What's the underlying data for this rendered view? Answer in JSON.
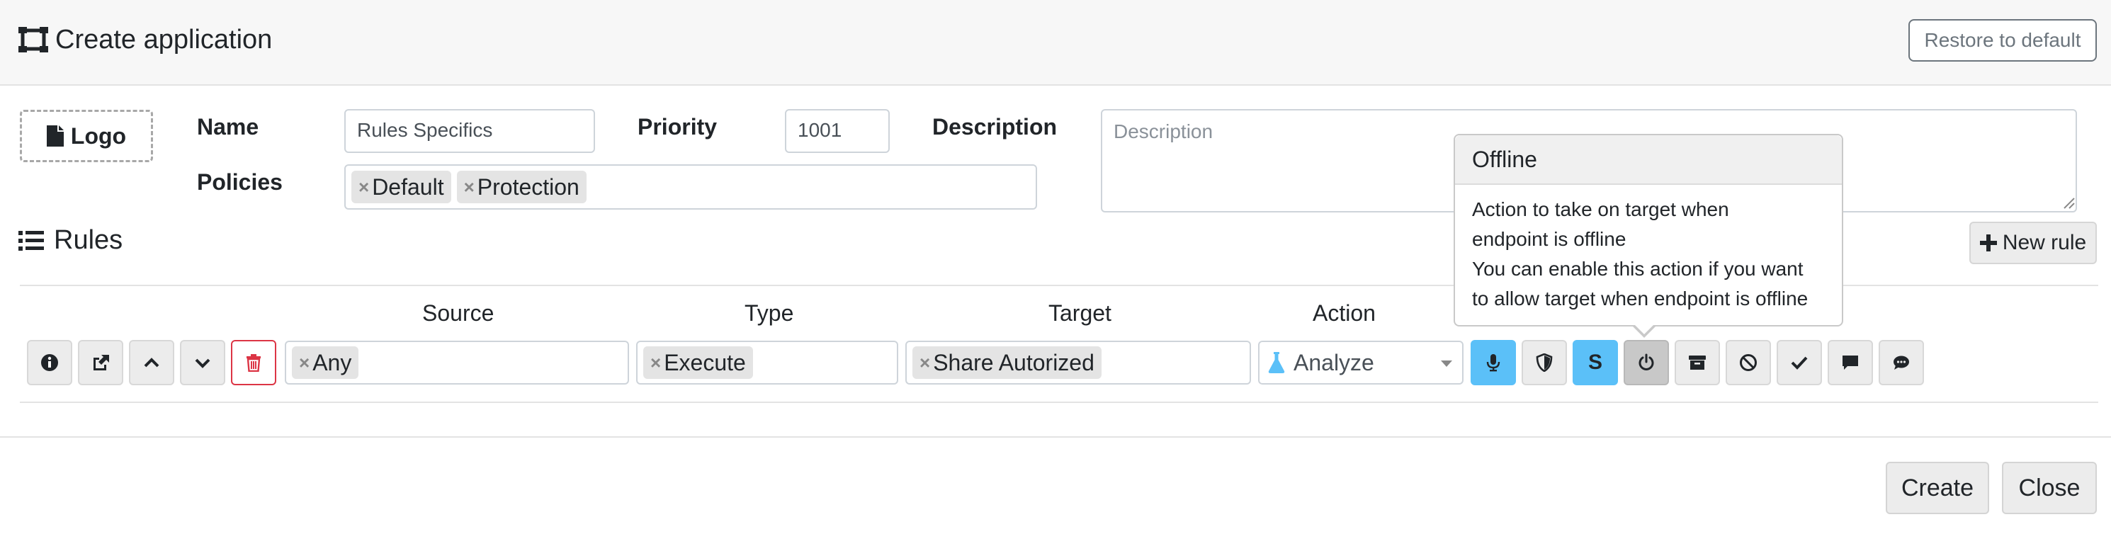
{
  "header": {
    "title": "Create application",
    "restore_label": "Restore to default"
  },
  "form": {
    "logo_label": "Logo",
    "name_label": "Name",
    "name_value": "Rules Specifics",
    "priority_label": "Priority",
    "priority_value": "1001",
    "description_label": "Description",
    "description_placeholder": "Description",
    "policies_label": "Policies",
    "policies": [
      "Default",
      "Protection"
    ]
  },
  "rules": {
    "heading": "Rules",
    "new_rule_label": "New rule",
    "columns": {
      "source": "Source",
      "type": "Type",
      "target": "Target",
      "action": "Action"
    },
    "row": {
      "source": "Any",
      "type": "Execute",
      "target": "Share Autorized",
      "action": "Analyze"
    },
    "row_buttons": [
      "info-icon",
      "share-icon",
      "chevron-up-icon",
      "chevron-down-icon",
      "trash-icon"
    ],
    "option_buttons": [
      "microphone-icon",
      "shield-icon",
      "S",
      "power-icon",
      "archive-icon",
      "ban-icon",
      "check-icon",
      "comment-icon",
      "comments-icon"
    ],
    "option_s_label": "S"
  },
  "popover": {
    "title": "Offline",
    "lines": [
      "Action to take on target when",
      "endpoint is offline",
      "You can enable this action if you want",
      "to allow target when endpoint is offline"
    ]
  },
  "footer": {
    "create_label": "Create",
    "close_label": "Close"
  },
  "colors": {
    "info": "#5bc0f8",
    "danger": "#dc3545",
    "active": "#c8c8c8"
  }
}
